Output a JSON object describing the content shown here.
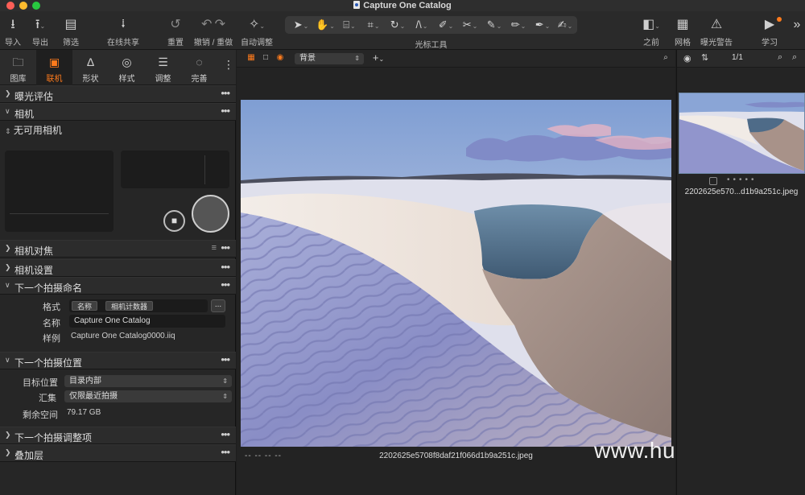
{
  "window": {
    "title": "Capture One Catalog",
    "traffic_colors": [
      "#ff5f57",
      "#febc2e",
      "#28c840"
    ]
  },
  "toolbar": {
    "import": "导入",
    "export": "导出",
    "filter": "筛选",
    "share": "在线共享",
    "reset": "重置",
    "undo_redo": "撤销 / 重做",
    "auto_adjust": "自动调整",
    "cursor_tools": "光标工具",
    "before": "之前",
    "grid": "网格",
    "exposure_warning": "曝光警告",
    "learn": "学习"
  },
  "tool_tabs": [
    {
      "label": "图库",
      "icon": "folder-icon"
    },
    {
      "label": "联机",
      "icon": "camera-icon",
      "active": true
    },
    {
      "label": "形状",
      "icon": "compass-icon"
    },
    {
      "label": "样式",
      "icon": "palette-icon"
    },
    {
      "label": "调整",
      "icon": "sliders-icon"
    },
    {
      "label": "完善",
      "icon": "refine-icon"
    }
  ],
  "sections": {
    "exposure_eval": "曝光评估",
    "camera": "相机",
    "camera_status": "无可用相机",
    "camera_focus": "相机对焦",
    "camera_settings": "相机设置",
    "next_capture_naming": "下一个拍摄命名",
    "next_capture_location": "下一个拍摄位置",
    "next_capture_adjustments": "下一个拍摄调整项",
    "overlay": "叠加层"
  },
  "naming": {
    "format_label": "格式",
    "tokens": [
      "名称",
      "相机计数器"
    ],
    "format_more": "...",
    "name_label": "名称",
    "name_value": "Capture One Catalog",
    "sample_label": "样例",
    "sample_value": "Capture One Catalog0000.iiq"
  },
  "location": {
    "target_label": "目标位置",
    "target_value": "目录内部",
    "collection_label": "汇集",
    "collection_value": "仅限最近拍摄",
    "free_space_label": "剩余空间",
    "free_space_value": "79.17 GB"
  },
  "viewer": {
    "background_select": "背景",
    "footer_dashes": "--   --   --   --",
    "filename": "2202625e5708f8daf21f066d1b9a251c.jpeg",
    "watermark": "www.hunls.com"
  },
  "browser": {
    "counter": "1/1",
    "thumb_name": "2202625e570...d1b9a251c.jpeg"
  },
  "colors": {
    "accent": "#ff7b1c",
    "panel": "#262626",
    "header": "#2c2c2c"
  }
}
